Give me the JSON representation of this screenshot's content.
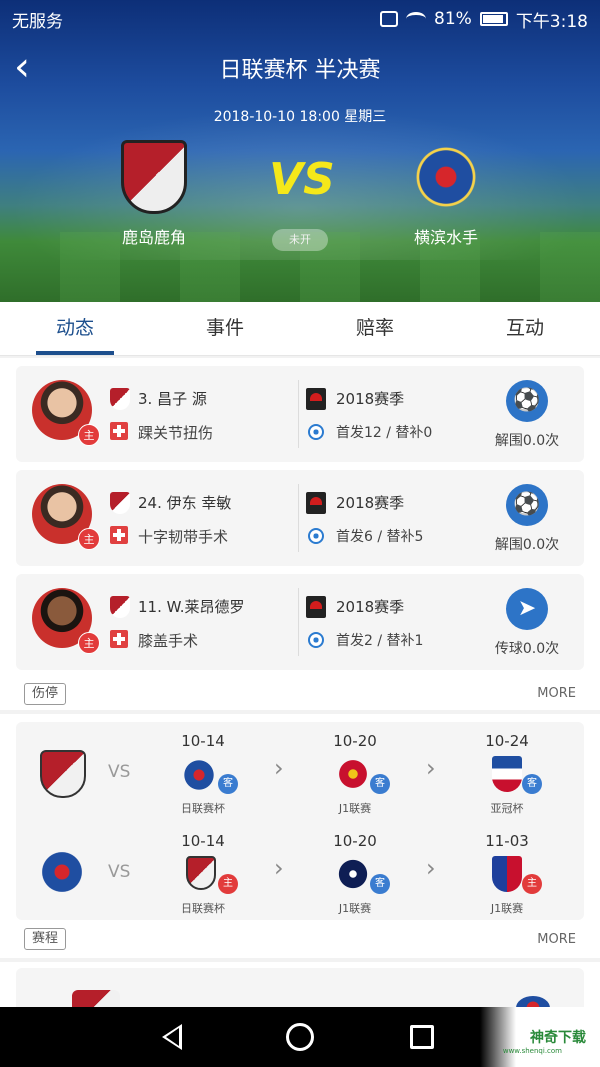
{
  "status_bar": {
    "carrier": "无服务",
    "battery": "81%",
    "time": "下午3:18"
  },
  "header": {
    "title": "日联赛杯 半决赛",
    "datetime": "2018-10-10   18:00   星期三",
    "home_team": "鹿岛鹿角",
    "away_team": "横滨水手",
    "vs": "VS",
    "status": "未开"
  },
  "tabs": [
    {
      "label": "动态",
      "active": true
    },
    {
      "label": "事件",
      "active": false
    },
    {
      "label": "赔率",
      "active": false
    },
    {
      "label": "互动",
      "active": false
    }
  ],
  "injuries": {
    "items": [
      {
        "player": "3. 昌子 源",
        "injury": "踝关节扭伤",
        "home_tag": "主",
        "season": "2018赛季",
        "apps": "首发12 / 替补0",
        "stat": "解围0.0次",
        "stat_icon": "clearance-icon"
      },
      {
        "player": "24. 伊东 幸敏",
        "injury": "十字韧带手术",
        "home_tag": "主",
        "season": "2018赛季",
        "apps": "首发6 / 替补5",
        "stat": "解围0.0次",
        "stat_icon": "clearance-icon"
      },
      {
        "player": "11. W.莱昂德罗",
        "injury": "膝盖手术",
        "home_tag": "主",
        "season": "2018赛季",
        "apps": "首发2 / 替补1",
        "stat": "传球0.0次",
        "stat_icon": "pass-icon"
      }
    ],
    "tag": "伤停",
    "more": "MORE"
  },
  "schedule": {
    "vs": "VS",
    "rows": [
      {
        "team_logo": "kashima",
        "fixtures": [
          {
            "date": "10-14",
            "comp": "日联赛杯",
            "badge": "客",
            "logo": "marinos"
          },
          {
            "date": "10-20",
            "comp": "J1联赛",
            "badge": "客",
            "logo": "urawa"
          },
          {
            "date": "10-24",
            "comp": "亚冠杯",
            "badge": "客",
            "logo": "suwon"
          }
        ]
      },
      {
        "team_logo": "marinos",
        "fixtures": [
          {
            "date": "10-14",
            "comp": "日联赛杯",
            "badge": "主",
            "logo": "kashima"
          },
          {
            "date": "10-20",
            "comp": "J1联赛",
            "badge": "客",
            "logo": "gamba"
          },
          {
            "date": "11-03",
            "comp": "J1联赛",
            "badge": "主",
            "logo": "fctokyo"
          }
        ]
      }
    ],
    "tag": "赛程",
    "more": "MORE"
  },
  "watermark": {
    "text": "神奇下载",
    "sub": "www.shenqi.com"
  },
  "colors": {
    "accent": "#1d4f8d",
    "home_badge": "#e23b3b",
    "away_badge": "#3a7cd0",
    "vs_yellow": "#f5e81a"
  }
}
